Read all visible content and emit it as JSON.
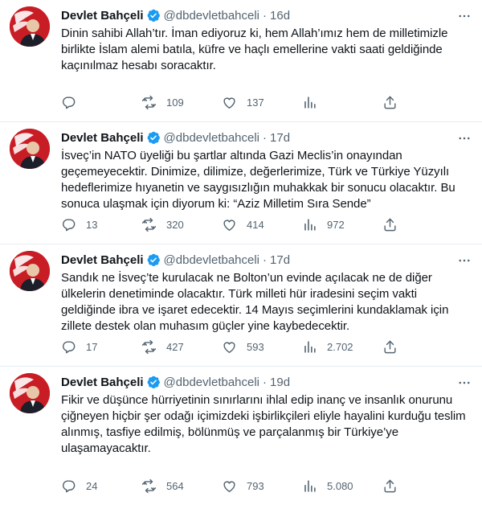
{
  "tweets": [
    {
      "name": "Devlet Bahçeli",
      "handle": "@dbdevletbahceli",
      "time": "16d",
      "text": "Dinin sahibi Allah’tır. İman ediyoruz ki, hem Allah’ımız hem de milletimizle\nbirlikte İslam alemi batıla, küfre ve haçlı emellerine vakti saati geldiğinde\nkaçınılmaz hesabı soracaktır.",
      "replies": "",
      "retweets": "109",
      "likes": "137",
      "views": ""
    },
    {
      "name": "Devlet Bahçeli",
      "handle": "@dbdevletbahceli",
      "time": "17d",
      "text": "İsveç’in NATO üyeliği bu şartlar altında Gazi Meclis’in onayından\ngeçemeyecektir. Dinimize, dilimize, değerlerimize, Türk ve Türkiye Yüzyılı\nhedeflerimize hıyanetin ve saygısızlığın muhakkak bir sonucu olacaktır. Bu\nsonuca ulaşmak için diyorum ki: “Aziz Milletim Sıra Sende”",
      "replies": "13",
      "retweets": "320",
      "likes": "414",
      "views": "972"
    },
    {
      "name": "Devlet Bahçeli",
      "handle": "@dbdevletbahceli",
      "time": "17d",
      "text": "Sandık ne İsveç’te kurulacak ne Bolton’un evinde açılacak ne de diğer\nülkelerin denetiminde olacaktır. Türk milleti hür iradesini seçim vakti\ngeldiğinde ibra ve işaret edecektir. 14 Mayıs seçimlerini kundaklamak için\nzillete destek olan muhasım güçler yine kaybedecektir.",
      "replies": "17",
      "retweets": "427",
      "likes": "593",
      "views": "2.702"
    },
    {
      "name": "Devlet Bahçeli",
      "handle": "@dbdevletbahceli",
      "time": "19d",
      "text": "Fikir ve düşünce hürriyetinin sınırlarını ihlal edip inanç ve insanlık onurunu\nçiğneyen hiçbir şer odağı içimizdeki işbirlikçileri eliyle hayalini kurduğu teslim\nalınmış, tasfiye edilmiş, bölünmüş ve parçalanmış bir Türkiye’ye\nulaşamayacaktır.",
      "replies": "24",
      "retweets": "564",
      "likes": "793",
      "views": "5.080"
    }
  ],
  "icons": {
    "verified": "verified-badge-icon",
    "more": "more-options-icon",
    "reply": "reply-icon",
    "retweet": "retweet-icon",
    "like": "like-icon",
    "views": "views-icon",
    "share": "share-icon"
  },
  "colors": {
    "verified": "#1d9bf0",
    "text": "#0f1419",
    "secondary": "#536471",
    "divider": "#e6ecf0",
    "avatar_bg": "#c81d25"
  }
}
